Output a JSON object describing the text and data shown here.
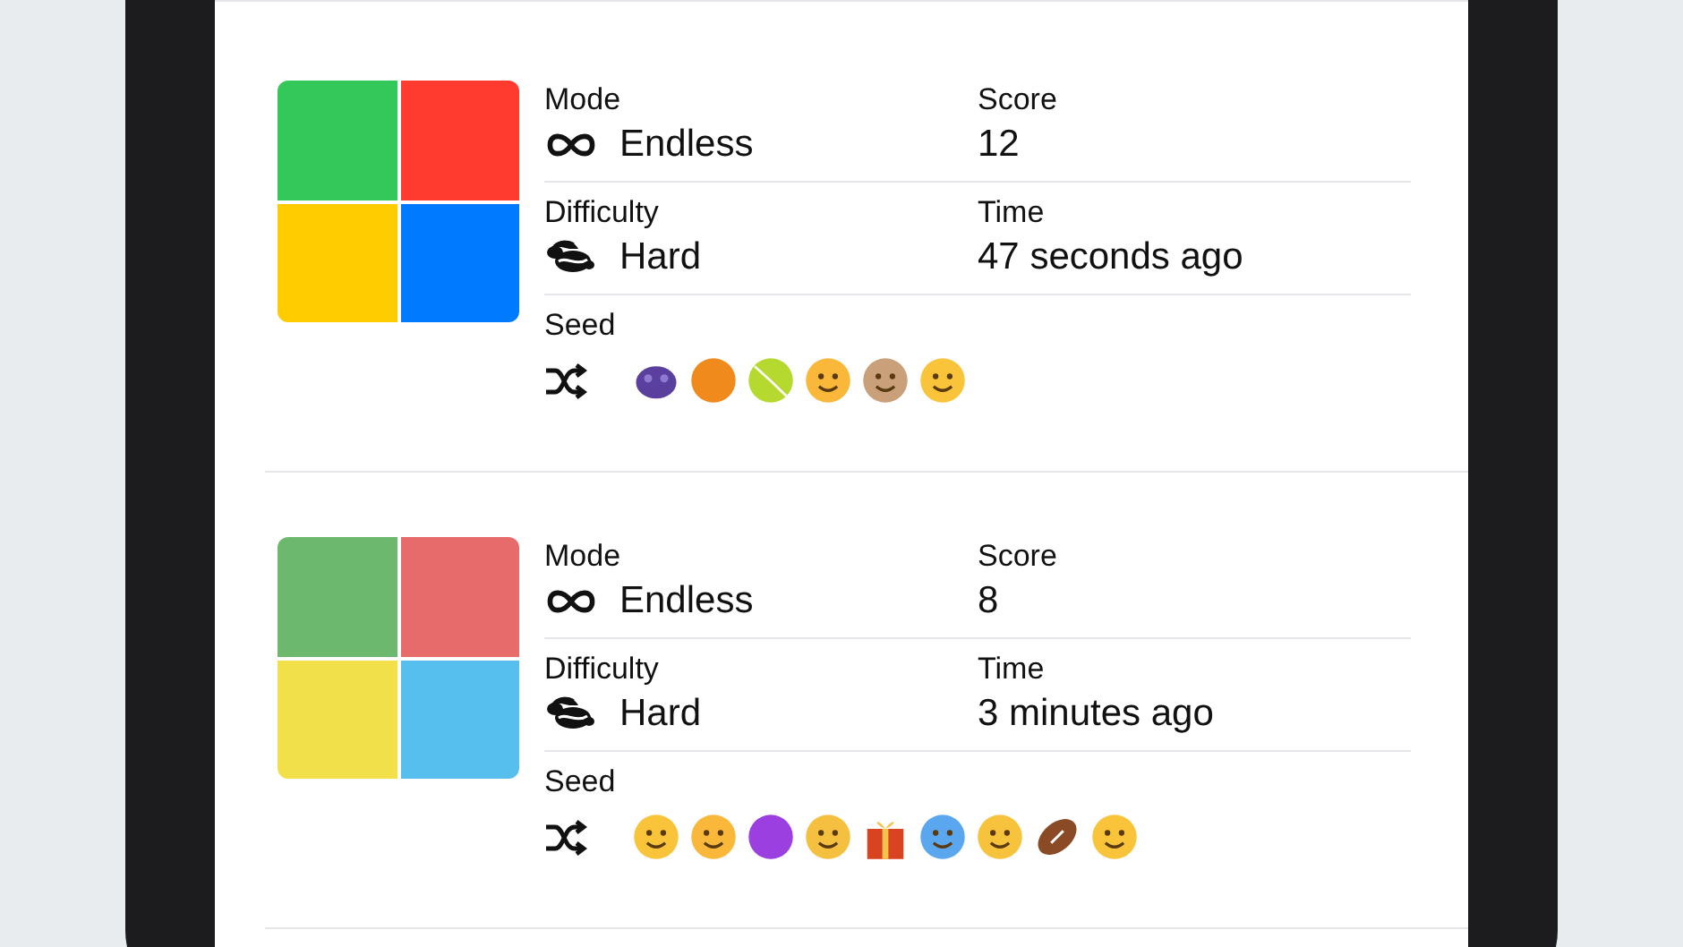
{
  "games": [
    {
      "grid": [
        {
          "color": "#34c759"
        },
        {
          "color": "#ff3b30"
        },
        {
          "color": "#ffcc00"
        },
        {
          "color": "#007aff"
        }
      ],
      "mode_label": "Mode",
      "mode": "Endless",
      "score_label": "Score",
      "score": "12",
      "difficulty_label": "Difficulty",
      "difficulty": "Hard",
      "time_label": "Time",
      "time": "47 seconds ago",
      "seed_label": "Seed",
      "seed": [
        {
          "kind": "bug",
          "color": "#5b3f9e"
        },
        {
          "kind": "ball",
          "color": "#f08a1c"
        },
        {
          "kind": "tennis",
          "color": "#b5d92e"
        },
        {
          "kind": "face",
          "color": "#f9b83a"
        },
        {
          "kind": "monkey",
          "color": "#c9a07a"
        },
        {
          "kind": "face",
          "color": "#f9c43a"
        }
      ]
    },
    {
      "grid": [
        {
          "color": "#6cb86f"
        },
        {
          "color": "#e86b6b"
        },
        {
          "color": "#f2e04a"
        },
        {
          "color": "#56bfee"
        }
      ],
      "mode_label": "Mode",
      "mode": "Endless",
      "score_label": "Score",
      "score": "8",
      "difficulty_label": "Difficulty",
      "difficulty": "Hard",
      "time_label": "Time",
      "time": "3 minutes ago",
      "seed_label": "Seed",
      "seed": [
        {
          "kind": "face",
          "color": "#f9c43a"
        },
        {
          "kind": "face",
          "color": "#f9b83a"
        },
        {
          "kind": "ball",
          "color": "#9b3fe0"
        },
        {
          "kind": "face",
          "color": "#f5c040"
        },
        {
          "kind": "gift",
          "color": "#d9431f"
        },
        {
          "kind": "face",
          "color": "#5aa7ef"
        },
        {
          "kind": "face",
          "color": "#f7c23c"
        },
        {
          "kind": "football",
          "color": "#8a4a26"
        },
        {
          "kind": "face",
          "color": "#f9c43a"
        }
      ]
    }
  ]
}
